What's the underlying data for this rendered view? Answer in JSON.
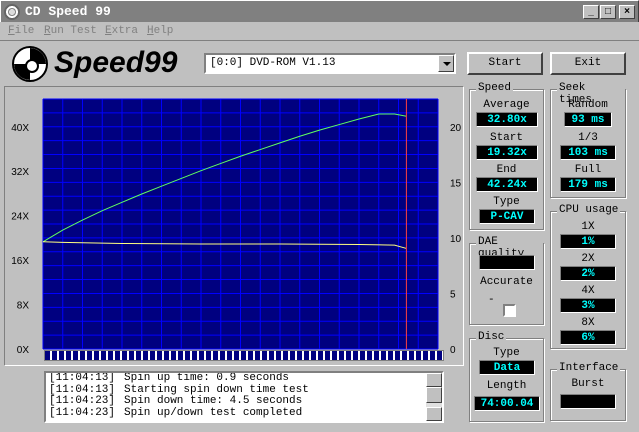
{
  "window": {
    "title": "CD Speed 99"
  },
  "menu": [
    "File",
    "Run Test",
    "Extra",
    "Help"
  ],
  "logo": {
    "text": "Speed99"
  },
  "drive": {
    "selected": "[0:0]      DVD-ROM V1.13"
  },
  "buttons": {
    "start": "Start",
    "exit": "Exit"
  },
  "speed": {
    "label": "Speed",
    "average_label": "Average",
    "average": "32.80x",
    "start_label": "Start",
    "start": "19.32x",
    "end_label": "End",
    "end": "42.24x",
    "type_label": "Type",
    "type": "P-CAV"
  },
  "seek": {
    "label": "Seek times",
    "random_label": "Random",
    "random": "93 ms",
    "third_label": "1/3",
    "third": "103 ms",
    "full_label": "Full",
    "full": "179 ms"
  },
  "cpu": {
    "label": "CPU usage",
    "x1_label": "1X",
    "x1": "1%",
    "x2_label": "2X",
    "x2": "2%",
    "x4_label": "4X",
    "x4": "3%",
    "x8_label": "8X",
    "x8": "6%"
  },
  "dae": {
    "label": "DAE quality",
    "value": "",
    "accurate_label": "Accurate",
    "dash": "-"
  },
  "disc": {
    "label": "Disc",
    "type_label": "Type",
    "type": "Data",
    "length_label": "Length",
    "length": "74:00.04"
  },
  "interface": {
    "label": "Interface",
    "burst_label": "Burst",
    "burst": ""
  },
  "progress": 1.0,
  "log": [
    {
      "time": "[11:04:13]",
      "msg": "Spin up time: 0.9 seconds"
    },
    {
      "time": "[11:04:13]",
      "msg": "Starting spin down time test"
    },
    {
      "time": "[11:04:23]",
      "msg": "Spin down time: 4.5 seconds"
    },
    {
      "time": "[11:04:23]",
      "msg": "Spin up/down test completed"
    }
  ],
  "colors": {
    "plot_bg": "#000080",
    "grid": "#0000ff",
    "speed_line": "#60ff60",
    "seek_line": "#ffff80",
    "marker": "#ff4040",
    "lcd_text": "#00ffff"
  },
  "chart_data": {
    "type": "line",
    "y_left_ticks": [
      "0X",
      "8X",
      "16X",
      "24X",
      "32X",
      "40X"
    ],
    "y_right_ticks": [
      "0",
      "5",
      "10",
      "15",
      "20"
    ],
    "y_left_lim": [
      0,
      45
    ],
    "y_right_lim": [
      0,
      22.5
    ],
    "x_lim": [
      0,
      100
    ],
    "series": [
      {
        "x": [
          0,
          5,
          10,
          15,
          20,
          25,
          30,
          35,
          40,
          45,
          50,
          55,
          60,
          65,
          70,
          75,
          80,
          85,
          89,
          92
        ],
        "y": [
          19.3,
          21.4,
          23.2,
          24.9,
          26.4,
          27.9,
          29.3,
          30.7,
          32.1,
          33.4,
          34.7,
          35.9,
          37.1,
          38.3,
          39.4,
          40.4,
          41.4,
          42.3,
          42.3,
          41.9
        ]
      },
      {
        "x": [
          0,
          5,
          20,
          40,
          60,
          80,
          89,
          92
        ],
        "y": [
          19.3,
          19.2,
          19.0,
          18.9,
          18.9,
          18.8,
          18.7,
          18.1
        ]
      }
    ],
    "marker_x": 92
  }
}
